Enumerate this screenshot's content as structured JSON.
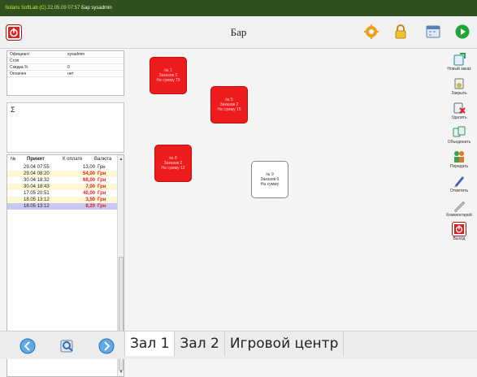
{
  "titlebar": {
    "app": "Solaris SoftLab (C)",
    "datetime": "22.05.09 07:57",
    "context": "Бар",
    "user": "sysadmin"
  },
  "header": {
    "title": "Бар"
  },
  "info": {
    "rows": [
      {
        "label": "Официант",
        "value": "sysadmin"
      },
      {
        "label": "Стол",
        "value": ""
      },
      {
        "label": "Скидка,%",
        "value": "0"
      },
      {
        "label": "Оплачен",
        "value": "нет"
      }
    ]
  },
  "sigma": {
    "symbol": "Σ"
  },
  "orders": {
    "headers": {
      "num": "№",
      "date": "Принят",
      "amount": "К оплате",
      "currency": "Валюта"
    },
    "rows": [
      {
        "date": "29.04 07:55",
        "amount": "13,00",
        "currency": "Грн",
        "highlight": false
      },
      {
        "date": "29.04 08:20",
        "amount": "54,00",
        "currency": "Грн",
        "highlight": true
      },
      {
        "date": "30.04 18:32",
        "amount": "68,00",
        "currency": "Грн",
        "highlight": true
      },
      {
        "date": "30.04 18:43",
        "amount": "7,00",
        "currency": "Грн",
        "highlight": true
      },
      {
        "date": "17.05 20:51",
        "amount": "40,00",
        "currency": "Грн",
        "highlight": true
      },
      {
        "date": "18.05 13:12",
        "amount": "3,50",
        "currency": "Грн",
        "highlight": true
      },
      {
        "date": "18.05 13:12",
        "amount": "8,20",
        "currency": "Грн",
        "highlight": true
      }
    ]
  },
  "tables": [
    {
      "num": "№ 1",
      "orders": "Заказов 2",
      "sum": "На сумму 79",
      "status": "busy"
    },
    {
      "num": "№ 5",
      "orders": "Заказов 2",
      "sum": "На сумму 15",
      "status": "busy"
    },
    {
      "num": "№ 8",
      "orders": "Заказов 2",
      "sum": "На сумму 12",
      "status": "busy"
    },
    {
      "num": "№ 9",
      "orders": "Заказов 0",
      "sum": "На сумму",
      "status": "free"
    }
  ],
  "toolbar": {
    "new_order": "Новый заказ",
    "close": "Закрыть",
    "delete": "Удалить",
    "merge": "Объединить",
    "transfer": "Передать",
    "mark": "Отметить",
    "comment": "Комментарий",
    "exit": "Выход"
  },
  "hall_tabs": [
    "Зал 1",
    "Зал 2",
    "Игровой центр"
  ],
  "colors": {
    "busy": "#ee1c1c",
    "accent": "#2f4f1e",
    "selected_row": "#c8c8f4"
  }
}
